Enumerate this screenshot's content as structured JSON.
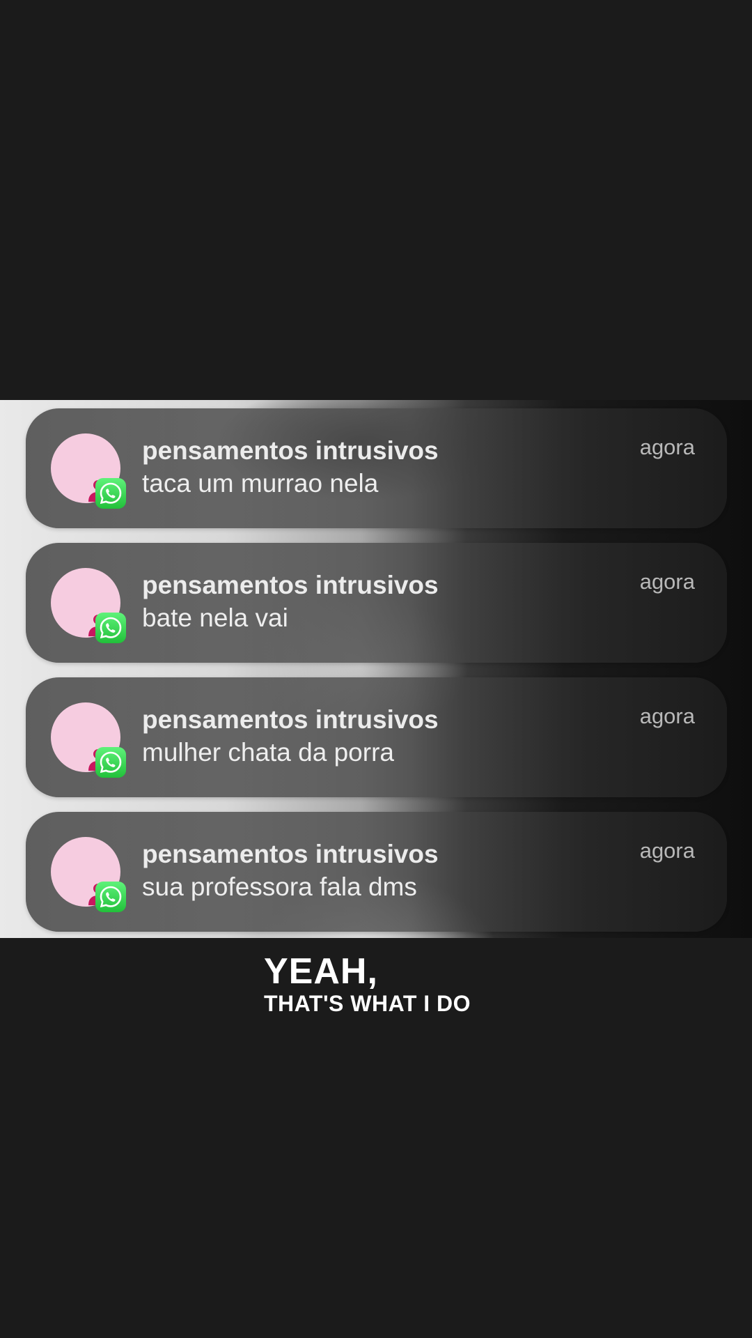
{
  "notifications": [
    {
      "sender": "pensamentos intrusivos",
      "message": "taca um murrao nela",
      "time": "agora",
      "icon": "person-icon",
      "badge": "whatsapp-icon"
    },
    {
      "sender": "pensamentos intrusivos",
      "message": "bate nela vai",
      "time": "agora",
      "icon": "person-icon",
      "badge": "whatsapp-icon"
    },
    {
      "sender": "pensamentos intrusivos",
      "message": "mulher chata da porra",
      "time": "agora",
      "icon": "person-icon",
      "badge": "whatsapp-icon"
    },
    {
      "sender": "pensamentos intrusivos",
      "message": "sua professora fala dms",
      "time": "agora",
      "icon": "person-icon",
      "badge": "whatsapp-icon"
    }
  ],
  "caption": {
    "line1": "YEAH,",
    "line2": "THAT'S WHAT I DO"
  },
  "colors": {
    "background": "#1b1b1b",
    "avatar_bg": "#f6cce0",
    "avatar_icon": "#c8175e",
    "whatsapp_green": "#25d366"
  }
}
